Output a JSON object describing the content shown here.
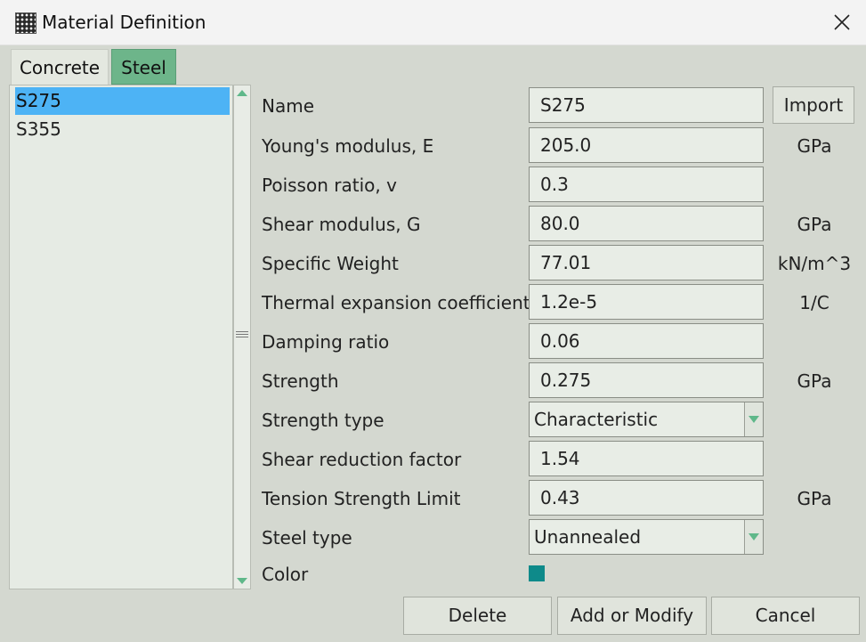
{
  "window": {
    "title": "Material Definition"
  },
  "tabs": [
    {
      "label": "Concrete",
      "active": false
    },
    {
      "label": "Steel",
      "active": true
    }
  ],
  "materials": [
    {
      "name": "S275",
      "selected": true
    },
    {
      "name": "S355",
      "selected": false
    }
  ],
  "form": {
    "name": {
      "label": "Name",
      "value": "S275"
    },
    "youngs_modulus": {
      "label": "Young's modulus, E",
      "value": "205.0",
      "unit": "GPa"
    },
    "poisson_ratio": {
      "label": "Poisson ratio, v",
      "value": "0.3"
    },
    "shear_modulus": {
      "label": "Shear modulus, G",
      "value": "80.0",
      "unit": "GPa"
    },
    "specific_weight": {
      "label": "Specific Weight",
      "value": "77.01",
      "unit": "kN/m^3"
    },
    "thermal_expansion": {
      "label": "Thermal expansion coefficient",
      "value": "1.2e-5",
      "unit": "1/C"
    },
    "damping_ratio": {
      "label": "Damping ratio",
      "value": "0.06"
    },
    "strength": {
      "label": "Strength",
      "value": "0.275",
      "unit": "GPa"
    },
    "strength_type": {
      "label": "Strength type",
      "value": "Characteristic"
    },
    "shear_reduction": {
      "label": "Shear reduction factor",
      "value": "1.54"
    },
    "tension_limit": {
      "label": "Tension Strength Limit",
      "value": "0.43",
      "unit": "GPa"
    },
    "steel_type": {
      "label": "Steel type",
      "value": "Unannealed"
    },
    "color": {
      "label": "Color",
      "value": "#0e8a8a"
    }
  },
  "buttons": {
    "import": "Import",
    "delete": "Delete",
    "add_modify": "Add or Modify",
    "cancel": "Cancel"
  },
  "colors": {
    "active_tab": "#6db58a",
    "selection": "#4db3f5",
    "accent_arrow": "#5fb88a"
  }
}
